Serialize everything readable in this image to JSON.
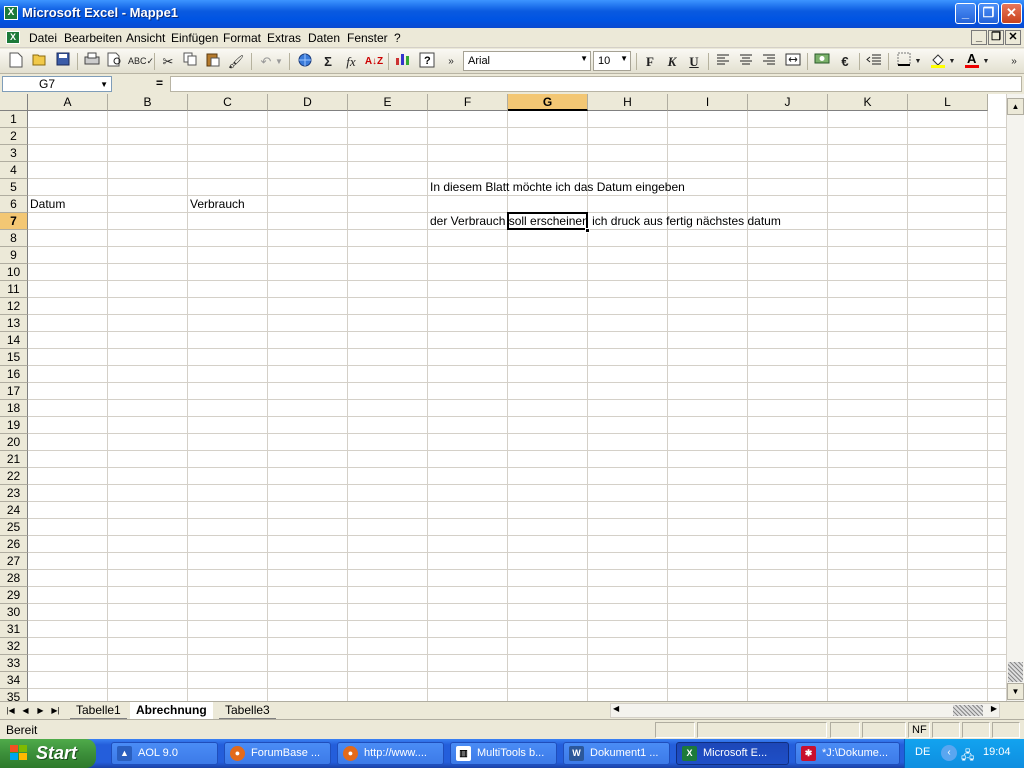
{
  "window": {
    "title": "Microsoft Excel - Mappe1",
    "min": "_",
    "restore": "❐",
    "close": "✕"
  },
  "menu": {
    "items": [
      "Datei",
      "Bearbeiten",
      "Ansicht",
      "Einfügen",
      "Format",
      "Extras",
      "Daten",
      "Fenster",
      "?"
    ]
  },
  "toolbar": {
    "font": "Arial",
    "size": "10",
    "bold": "F",
    "italic": "K",
    "underline": "U",
    "euro": "€",
    "sum": "Σ",
    "fx": "fx",
    "sort": "A↓Z"
  },
  "formula_bar": {
    "name_box": "G7",
    "equals": "="
  },
  "grid": {
    "columns": [
      "A",
      "B",
      "C",
      "D",
      "E",
      "F",
      "G",
      "H",
      "I",
      "J",
      "K",
      "L"
    ],
    "rows": [
      "1",
      "2",
      "3",
      "4",
      "5",
      "6",
      "7",
      "8",
      "9",
      "10",
      "11",
      "12",
      "13",
      "14",
      "15",
      "16",
      "17",
      "18",
      "19",
      "20",
      "21",
      "22",
      "23",
      "24",
      "25",
      "26",
      "27",
      "28",
      "29",
      "30",
      "31",
      "32",
      "33",
      "34",
      "35"
    ],
    "selected_column": "G",
    "selected_row": "7",
    "cells": {
      "F5": "In diesem Blatt möchte ich das Datum eingeben",
      "A6": "Datum",
      "C6": "Verbrauch",
      "F7": "der Verbrauch soll erscheinen ich druck aus fertig nächstes datum"
    }
  },
  "sheet_tabs": {
    "tabs": [
      "Tabelle1",
      "Abrechnung",
      "Tabelle3"
    ],
    "active": "Abrechnung"
  },
  "status": {
    "text": "Bereit",
    "nf": "NF"
  },
  "taskbar": {
    "start": "Start",
    "items": [
      "AOL 9.0",
      "ForumBase ...",
      "http://www....",
      "MultiTools b...",
      "Dokument1 ...",
      "Microsoft E...",
      "*J:\\Dokume..."
    ],
    "active": "Microsoft E...",
    "lang": "DE",
    "clock": "19:04"
  },
  "colors": {
    "selection_header": "#f3c774",
    "title_bar": "#0054e3",
    "taskbar": "#245edb",
    "start_button": "#3c8f3a"
  }
}
